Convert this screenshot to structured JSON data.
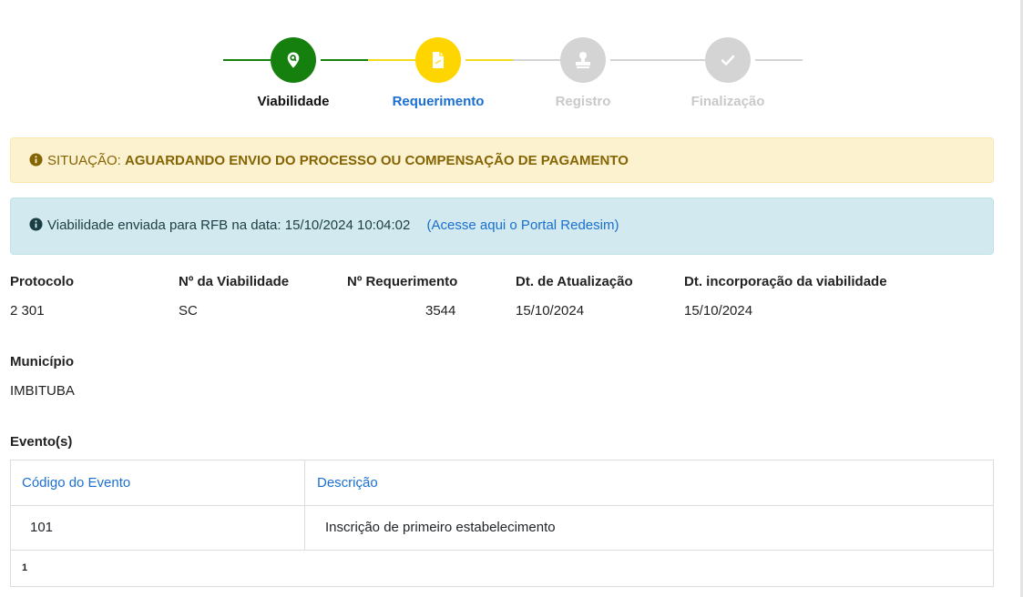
{
  "stepper": {
    "steps": [
      {
        "label": "Viabilidade",
        "icon": "search-location-icon",
        "state": "done"
      },
      {
        "label": "Requerimento",
        "icon": "document-icon",
        "state": "active"
      },
      {
        "label": "Registro",
        "icon": "stamp-icon",
        "state": "pending"
      },
      {
        "label": "Finalização",
        "icon": "check-icon",
        "state": "pending"
      }
    ]
  },
  "status": {
    "icon": "info-circle-icon",
    "prefix": "SITUAÇÃO:",
    "text": "AGUARDANDO ENVIO DO PROCESSO OU COMPENSAÇÃO DE PAGAMENTO"
  },
  "info": {
    "icon": "info-circle-icon",
    "text": "Viabilidade enviada para RFB na data: 15/10/2024 10:04:02",
    "link_text": "(Acesse aqui o Portal Redesim)"
  },
  "fields": {
    "protocolo": {
      "label": "Protocolo",
      "value": "2                301"
    },
    "viabilidade": {
      "label": "Nº da Viabilidade",
      "value": "SC"
    },
    "requerimento": {
      "label": "Nº Requerimento",
      "value": "3544"
    },
    "atualizacao": {
      "label": "Dt. de Atualização",
      "value": "15/10/2024"
    },
    "incorporacao": {
      "label": "Dt. incorporação da viabilidade",
      "value": "15/10/2024"
    },
    "municipio": {
      "label": "Município",
      "value": "IMBITUBA"
    }
  },
  "eventos": {
    "title": "Evento(s)",
    "columns": [
      "Código do Evento",
      "Descrição"
    ],
    "rows": [
      {
        "codigo": "101",
        "descricao": "Inscrição de primeiro estabelecimento"
      }
    ],
    "page": "1"
  },
  "colors": {
    "done": "#16800f",
    "active": "#ffd500",
    "pending": "#d4d4d4",
    "link": "#1a6fd1",
    "warning_bg": "#fdf2d0",
    "info_bg": "#d2eaef"
  }
}
